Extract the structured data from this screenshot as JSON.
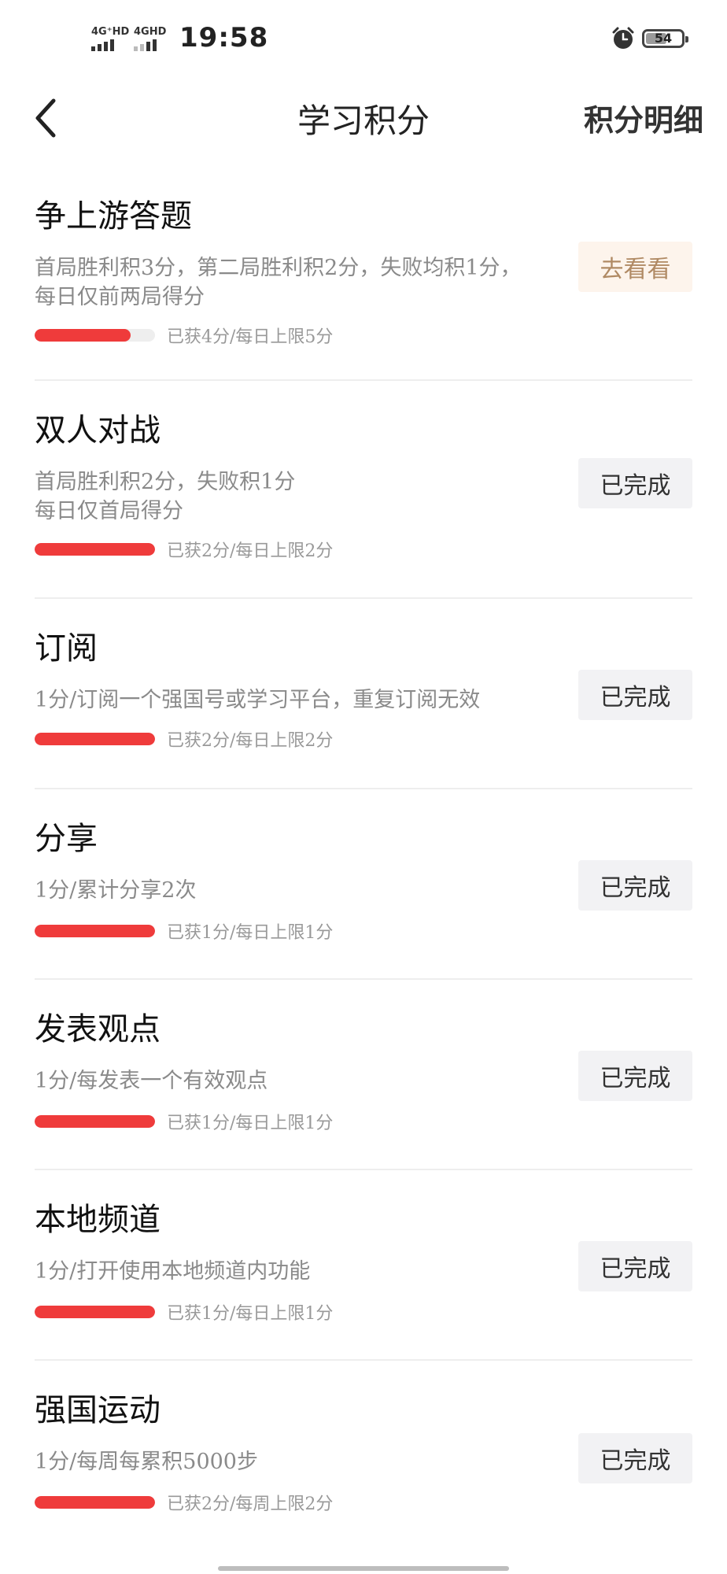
{
  "status_bar": {
    "network1": "4G⁺HD",
    "network2": "4GHD",
    "time": "19:58",
    "battery": "54"
  },
  "header": {
    "title": "学习积分",
    "right_link": "积分明细"
  },
  "tasks": [
    {
      "title": "争上游答题",
      "desc": "首局胜利积3分，第二局胜利积2分，失败均积1分，每日仅前两局得分",
      "progress_text": "已获4分/每日上限5分",
      "progress": 0.8,
      "button": "去看看",
      "state": "go"
    },
    {
      "title": "双人对战",
      "desc": "首局胜利积2分，失败积1分\n每日仅首局得分",
      "progress_text": "已获2分/每日上限2分",
      "progress": 1.0,
      "button": "已完成",
      "state": "done"
    },
    {
      "title": "订阅",
      "desc": "1分/订阅一个强国号或学习平台，重复订阅无效",
      "progress_text": "已获2分/每日上限2分",
      "progress": 1.0,
      "button": "已完成",
      "state": "done"
    },
    {
      "title": "分享",
      "desc": "1分/累计分享2次",
      "progress_text": "已获1分/每日上限1分",
      "progress": 1.0,
      "button": "已完成",
      "state": "done"
    },
    {
      "title": "发表观点",
      "desc": "1分/每发表一个有效观点",
      "progress_text": "已获1分/每日上限1分",
      "progress": 1.0,
      "button": "已完成",
      "state": "done"
    },
    {
      "title": "本地频道",
      "desc": "1分/打开使用本地频道内功能",
      "progress_text": "已获1分/每日上限1分",
      "progress": 1.0,
      "button": "已完成",
      "state": "done"
    },
    {
      "title": "强国运动",
      "desc": "1分/每周每累积5000步",
      "progress_text": "已获2分/每周上限2分",
      "progress": 1.0,
      "button": "已完成",
      "state": "done"
    }
  ],
  "colors": {
    "progress_fill": "#ef3b3b",
    "progress_track": "#eeeeee",
    "go_button_bg": "#fdf4ec",
    "go_button_text": "#b08a64",
    "done_button_bg": "#f2f2f4"
  },
  "icons": [
    "back-arrow-icon",
    "alarm-clock-icon",
    "battery-icon",
    "signal-icon"
  ]
}
